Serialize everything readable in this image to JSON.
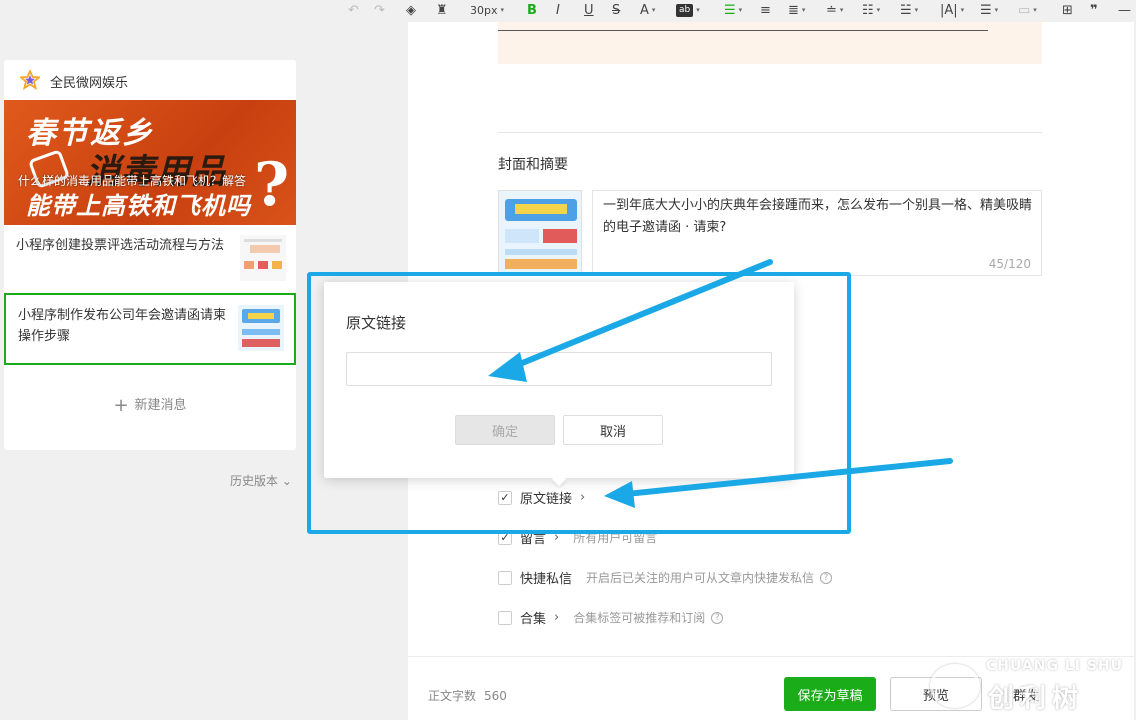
{
  "toolbar": {
    "font_size": "30px",
    "bold": "B",
    "italic": "I",
    "underline": "U",
    "strike": "S",
    "font_color": "A",
    "bg_color": "ab"
  },
  "sidebar": {
    "account_name": "全民微网娱乐",
    "banner": {
      "line1": "春节返乡",
      "line2": "消毒用品",
      "line3": "能带上高铁和飞机吗",
      "caption": "什么样的消毒用品能带上高铁和飞机？解答"
    },
    "articles": [
      {
        "title": "小程序创建投票评选活动流程与方法"
      },
      {
        "title": "小程序制作发布公司年会邀请函请柬操作步骤"
      }
    ],
    "new_message": "新建消息",
    "history": "历史版本"
  },
  "editor": {
    "section_title": "封面和摘要",
    "digest_text": "一到年底大大小小的庆典年会接踵而来，怎么发布一个别具一格、精美吸睛的电子邀请函 · 请柬?",
    "digest_count": "45/120",
    "options": [
      {
        "label": "原文链接",
        "desc": "",
        "checked": true
      },
      {
        "label": "留言",
        "desc": "所有用户可留言",
        "checked": true
      },
      {
        "label": "快捷私信",
        "desc": "开启后已关注的用户可从文章内快捷发私信",
        "checked": false
      },
      {
        "label": "合集",
        "desc": "合集标签可被推荐和订阅",
        "checked": false
      }
    ]
  },
  "footer": {
    "word_count_label": "正文字数",
    "word_count": "560",
    "save_draft": "保存为草稿",
    "preview": "预览",
    "mass_send": "群发"
  },
  "dialog": {
    "title": "原文链接",
    "input_value": "",
    "input_placeholder": "",
    "ok_label": "确定",
    "cancel_label": "取消"
  },
  "watermark": {
    "en": "CHUANG LI SHU",
    "cn": "创利树"
  },
  "colors": {
    "accent_green": "#1aad19",
    "annotation_blue": "#1aa9e6",
    "banner_orange": "#d9531a"
  }
}
